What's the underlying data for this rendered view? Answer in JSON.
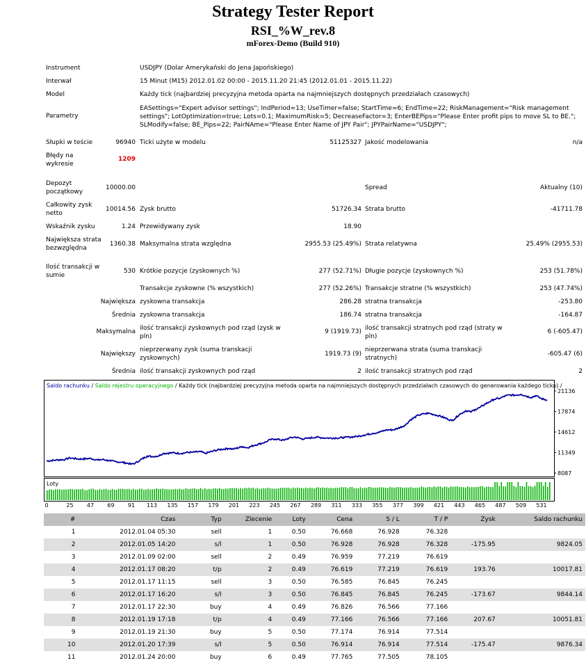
{
  "header": {
    "title": "Strategy Tester Report",
    "ea_name": "RSI_%W_rev.8",
    "broker": "mForex-Demo (Build 910)"
  },
  "info": {
    "instrument_label": "Instrument",
    "instrument_value": "USDJPY (Dolar Amerykański do Jena Japońskiego)",
    "interval_label": "Interwał",
    "interval_value": "15 Minut (M15) 2012.01.02 00:00 - 2015.11.20 21:45 (2012.01.01 - 2015.11.22)",
    "model_label": "Model",
    "model_value": "Każdy tick (najbardziej precyzyjna metoda oparta na najmniejszych dostępnych przedziałach czasowych)",
    "params_label": "Parametry",
    "params_value": "EASettings=\"Expert advisor settings\"; IndPeriod=13; UseTimer=false; StartTime=6; EndTime=22; RiskManagement=\"Risk management settings\"; LotOptimization=true; Lots=0.1; MaximumRisk=5; DecreaseFactor=3; EnterBEPips=\"Please Enter profit pips to move SL to BE.\"; SLModify=false; BE_Pips=22; PairNAme=\"Please Enter Name of JPY Pair\"; JPYPairName=\"USDJPY\";",
    "bars_label": "Słupki w teście",
    "bars_value": "96940",
    "ticks_label": "Ticki użyte w modelu",
    "ticks_value": "51125327",
    "quality_label": "Jakość modelowania",
    "quality_value": "n/a",
    "errors_label": "Błędy na wykresie",
    "errors_value": "1209",
    "deposit_label": "Depozyt początkowy",
    "deposit_value": "10000.00",
    "spread_label": "Spread",
    "spread_value": "Aktualny (10)",
    "net_label": "Całkowity zysk netto",
    "net_value": "10014.56",
    "gross_profit_label": "Zysk brutto",
    "gross_profit_value": "51726.34",
    "gross_loss_label": "Strata brutto",
    "gross_loss_value": "-41711.78",
    "pf_label": "Wskaźnik zysku",
    "pf_value": "1.24",
    "payoff_label": "Przewidywany zysk",
    "payoff_value": "18.90",
    "abs_dd_label": "Największa strata bezwzględna",
    "abs_dd_value": "1360.38",
    "max_dd_label": "Maksymalna strata względna",
    "max_dd_value": "2955.53 (25.49%)",
    "rel_dd_label": "Strata relatywna",
    "rel_dd_value": "25.49% (2955.53)",
    "total_trades_label": "Ilość transakcji w sumie",
    "total_trades_value": "530",
    "short_label": "Krótkie pozycje (zyskownych %)",
    "short_value": "277 (52.71%)",
    "long_label": "Długie pozycje (zyskownych %)",
    "long_value": "253 (51.78%)",
    "profit_trades_label": "Transakcje zyskowne (% wszystkich)",
    "profit_trades_value": "277 (52.26%)",
    "loss_trades_label": "Transakcje stratne (% wszystkich)",
    "loss_trades_value": "253 (47.74%)",
    "largest_label": "Największa",
    "largest_profit_label": "zyskowna transakcja",
    "largest_profit_value": "286.28",
    "largest_loss_label": "stratna transakcja",
    "largest_loss_value": "-253.80",
    "average_label": "Średnia",
    "avg_profit_label": "zyskowna transakcja",
    "avg_profit_value": "186.74",
    "avg_loss_label": "stratna transakcja",
    "avg_loss_value": "-164.87",
    "maximum_label": "Maksymalna",
    "max_cons_wins_label": "ilość transakcji zyskownych pod rząd (zysk w pln)",
    "max_cons_wins_value": "9 (1919.73)",
    "max_cons_losses_label": "ilość transakcji stratnych pod rząd (straty w pln)",
    "max_cons_losses_value": "6 (-605.47)",
    "biggest_label": "Największy",
    "max_cons_profit_label": "nieprzerwany zysk (suma transkacji zyskownych)",
    "max_cons_profit_value": "1919.73 (9)",
    "max_cons_loss_label": "nieprzerwana strata (suma transkacji stratnych)",
    "max_cons_loss_value": "-605.47 (6)",
    "average2_label": "Średnia",
    "avg_cons_wins_label": "ilość transakcji zyskownych pod rząd",
    "avg_cons_wins_value": "2",
    "avg_cons_losses_label": "ilość transakcji stratnych pod rząd",
    "avg_cons_losses_value": "2"
  },
  "chart": {
    "legend_balance": "Saldo rachunku",
    "legend_sep1": " / ",
    "legend_equity": "Saldo rejestru operacyjnego",
    "legend_sep2": " / ",
    "legend_model": "Każdy tick (najbardziej precyzyjna metoda oparta na najmniejszych dostępnych przedziałach czasowych do generowania każdego ticku)",
    "legend_end": " /",
    "lots_label": "Loty",
    "colors": {
      "balance": "#0000a0",
      "equity": "#00b000",
      "lots": "#00b000"
    }
  },
  "chart_data": {
    "type": "line",
    "ylim": [
      8087,
      21136
    ],
    "y_ticks": [
      21136,
      17874,
      14612,
      11349,
      8087
    ],
    "x_ticks": [
      0,
      25,
      47,
      69,
      91,
      113,
      135,
      157,
      179,
      201,
      223,
      245,
      267,
      289,
      311,
      333,
      355,
      377,
      399,
      421,
      443,
      465,
      487,
      509,
      531
    ],
    "xlim": [
      0,
      540
    ],
    "series": [
      {
        "name": "Saldo rachunku",
        "x": [
          0,
          10,
          20,
          25,
          35,
          47,
          55,
          60,
          69,
          75,
          80,
          85,
          91,
          95,
          100,
          108,
          113,
          120,
          125,
          135,
          145,
          150,
          157,
          165,
          170,
          179,
          185,
          195,
          201,
          210,
          215,
          223,
          228,
          235,
          240,
          245,
          255,
          260,
          267,
          275,
          280,
          289,
          295,
          300,
          311,
          320,
          325,
          333,
          340,
          350,
          355,
          365,
          372,
          377,
          385,
          390,
          399,
          405,
          410,
          415,
          421,
          430,
          435,
          443,
          450,
          455,
          460,
          465,
          470,
          475,
          480,
          487,
          493,
          498,
          503,
          509,
          515,
          520,
          525,
          531,
          537
        ],
        "values": [
          10000,
          10150,
          10250,
          10500,
          10300,
          10400,
          10150,
          10250,
          10000,
          9900,
          9800,
          9700,
          9500,
          9650,
          10100,
          10800,
          10700,
          10800,
          11200,
          11300,
          11200,
          11350,
          11400,
          11500,
          11200,
          11600,
          11800,
          12000,
          11900,
          12300,
          12100,
          12500,
          12700,
          13000,
          13400,
          13500,
          13300,
          13650,
          13800,
          13500,
          13600,
          13800,
          13700,
          13650,
          13650,
          13750,
          13800,
          13900,
          14100,
          14400,
          14500,
          14950,
          14950,
          15200,
          15700,
          16500,
          17300,
          17500,
          17600,
          17400,
          17200,
          16700,
          16400,
          17400,
          18000,
          17800,
          18200,
          18500,
          19000,
          19400,
          19800,
          20000,
          20400,
          20500,
          20450,
          20600,
          20300,
          20100,
          20400,
          19900,
          19700
        ]
      }
    ]
  },
  "trades": {
    "headers": [
      "#",
      "Czas",
      "Typ",
      "Zlecenie",
      "Loty",
      "Cena",
      "S / L",
      "T / P",
      "Zysk",
      "Saldo rachunku"
    ],
    "rows": [
      [
        "1",
        "2012.01.04 05:30",
        "sell",
        "1",
        "0.50",
        "76.668",
        "76.928",
        "76.328",
        "",
        ""
      ],
      [
        "2",
        "2012.01.05 14:20",
        "s/l",
        "1",
        "0.50",
        "76.928",
        "76.928",
        "76.328",
        "-175.95",
        "9824.05"
      ],
      [
        "3",
        "2012.01.09 02:00",
        "sell",
        "2",
        "0.49",
        "76.959",
        "77.219",
        "76.619",
        "",
        ""
      ],
      [
        "4",
        "2012.01.17 08:20",
        "t/p",
        "2",
        "0.49",
        "76.619",
        "77.219",
        "76.619",
        "193.76",
        "10017.81"
      ],
      [
        "5",
        "2012.01.17 11:15",
        "sell",
        "3",
        "0.50",
        "76.585",
        "76.845",
        "76.245",
        "",
        ""
      ],
      [
        "6",
        "2012.01.17 16:20",
        "s/l",
        "3",
        "0.50",
        "76.845",
        "76.845",
        "76.245",
        "-173.67",
        "9844.14"
      ],
      [
        "7",
        "2012.01.17 22:30",
        "buy",
        "4",
        "0.49",
        "76.826",
        "76.566",
        "77.166",
        "",
        ""
      ],
      [
        "8",
        "2012.01.19 17:18",
        "t/p",
        "4",
        "0.49",
        "77.166",
        "76.566",
        "77.166",
        "207.67",
        "10051.81"
      ],
      [
        "9",
        "2012.01.19 21:30",
        "buy",
        "5",
        "0.50",
        "77.174",
        "76.914",
        "77.514",
        "",
        ""
      ],
      [
        "10",
        "2012.01.20 17:39",
        "s/l",
        "5",
        "0.50",
        "76.914",
        "76.914",
        "77.514",
        "-175.47",
        "9876.34"
      ],
      [
        "11",
        "2012.01.24 20:00",
        "buy",
        "6",
        "0.49",
        "77.765",
        "77.505",
        "78.105",
        "",
        ""
      ]
    ]
  }
}
